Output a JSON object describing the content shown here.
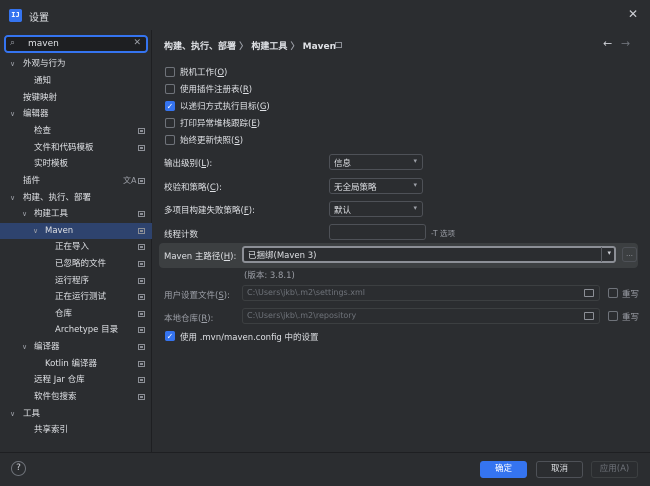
{
  "window": {
    "title": "设置",
    "app_icon": "IJ"
  },
  "search": {
    "value": "maven"
  },
  "tree": [
    {
      "label": "外观与行为",
      "arrow": "∨"
    },
    {
      "label": "通知"
    },
    {
      "label": "按键映射"
    },
    {
      "label": "编辑器",
      "arrow": "∨"
    },
    {
      "label": "检查",
      "pg": true
    },
    {
      "label": "文件和代码模板",
      "pg": true
    },
    {
      "label": "实时模板"
    },
    {
      "label": "插件"
    },
    {
      "label": "构建、执行、部署",
      "arrow": "∨"
    },
    {
      "label": "构建工具",
      "arrow": "∨",
      "pg": true
    },
    {
      "label": "Maven",
      "arrow": "∨",
      "pg": true
    },
    {
      "label": "正在导入",
      "pg": true
    },
    {
      "label": "已忽略的文件",
      "pg": true
    },
    {
      "label": "运行程序",
      "pg": true
    },
    {
      "label": "正在运行测试",
      "pg": true
    },
    {
      "label": "仓库",
      "pg": true
    },
    {
      "label": "Archetype 目录",
      "pg": true
    },
    {
      "label": "编译器",
      "arrow": "∨",
      "pg": true
    },
    {
      "label": "Kotlin 编译器",
      "pg": true
    },
    {
      "label": "远程 Jar 仓库",
      "pg": true
    },
    {
      "label": "软件包搜索",
      "pg": true
    },
    {
      "label": "工具",
      "arrow": "∨"
    },
    {
      "label": "共享索引"
    }
  ],
  "breadcrumb": {
    "part1": "构建、执行、部署",
    "sep": "〉",
    "part2": "构建工具",
    "part3": "Maven"
  },
  "checkboxes": [
    {
      "text": "脱机工作(",
      "key": "O",
      "end": ")",
      "checked": false
    },
    {
      "text": "使用插件注册表(",
      "key": "R",
      "end": ")",
      "checked": false
    },
    {
      "text": "以递归方式执行目标(",
      "key": "G",
      "end": ")",
      "checked": true
    },
    {
      "text": "打印异常堆栈跟踪(",
      "key": "E",
      "end": ")",
      "checked": false
    },
    {
      "text": "始终更新快照(",
      "key": "S",
      "end": ")",
      "checked": false
    }
  ],
  "output_level": {
    "label": "输出级别(",
    "key": "L",
    "end": "):",
    "value": "信息"
  },
  "checksum_policy": {
    "label": "校验和策略(",
    "key": "C",
    "end": "):",
    "value": "无全局策略"
  },
  "failure_policy": {
    "label": "多项目构建失败策略(",
    "key": "F",
    "end": "):",
    "value": "默认"
  },
  "thread_count": {
    "label": "线程计数",
    "hint": "-T 选项"
  },
  "maven_home": {
    "label": "Maven 主路径(",
    "key": "H",
    "end": "):",
    "value": "已捆绑(Maven 3)",
    "version": "(版本: 3.8.1)"
  },
  "user_settings": {
    "label": "用户设置文件(",
    "key": "S",
    "end": "):",
    "value": "C:\\Users\\jkb\\.m2\\settings.xml",
    "override": "重写"
  },
  "local_repo": {
    "label": "本地仓库(",
    "key": "R",
    "end": "):",
    "value": "C:\\Users\\jkb\\.m2\\repository",
    "override": "重写"
  },
  "use_config": {
    "text": "使用 .mvn/maven.config 中的设置",
    "checked": true
  },
  "footer": {
    "help": "?",
    "ok": "确定",
    "cancel": "取消",
    "apply": "应用(A)"
  },
  "colors": {
    "accent": "#3574f0",
    "background": "#2b2d30",
    "selected": "#2e436e"
  }
}
